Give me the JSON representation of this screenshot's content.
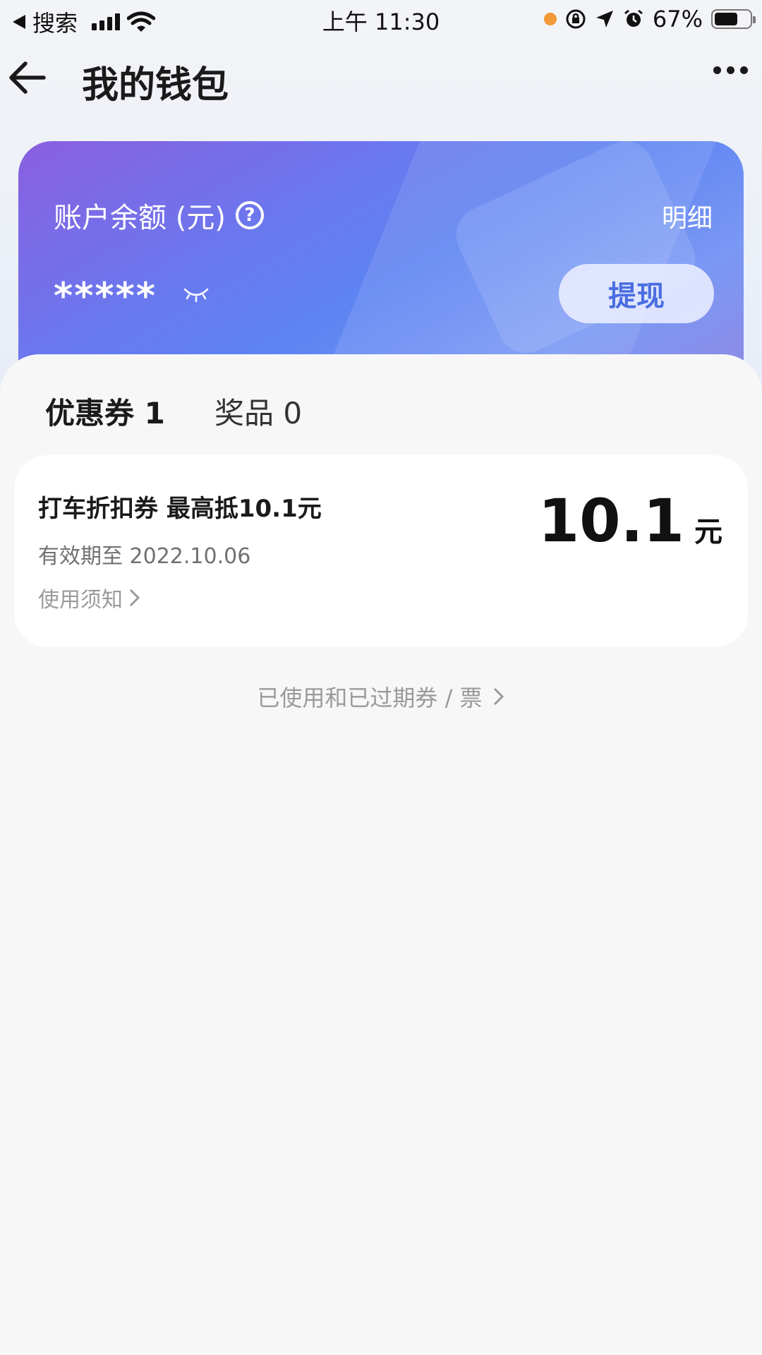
{
  "status_bar": {
    "back_app": "搜索",
    "time": "上午 11:30",
    "battery_percent": "67%",
    "battery_level": 0.67
  },
  "header": {
    "title": "我的钱包"
  },
  "balance_card": {
    "label": "账户余额 (元)",
    "help_symbol": "?",
    "detail_link": "明细",
    "masked_value": "*****",
    "withdraw_label": "提现"
  },
  "tabs": [
    {
      "label": "优惠券 1",
      "active": true
    },
    {
      "label": "奖品 0",
      "active": false
    }
  ],
  "coupon": {
    "title": "打车折扣券  最高抵10.1元",
    "expiry": "有效期至 2022.10.06",
    "notice": "使用须知",
    "amount": "10.1",
    "unit": "元"
  },
  "history_link": "已使用和已过期券 / 票",
  "colors": {
    "accent": "#4a6ee0",
    "card_gradient_start": "#8a5fe0",
    "card_gradient_end": "#5d84f2",
    "status_dot": "#f29a38"
  }
}
